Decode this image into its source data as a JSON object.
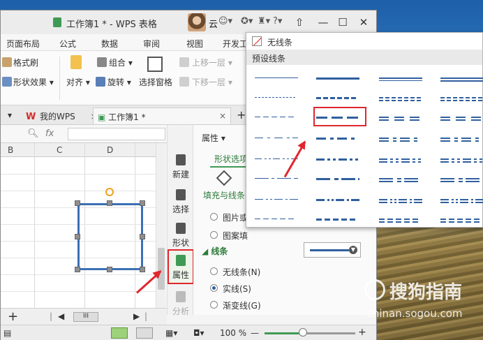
{
  "window": {
    "title": "工作簿1 * - WPS 表格",
    "user": "云",
    "help": "?"
  },
  "menu": [
    "页面布局",
    "公式",
    "数据",
    "审阅",
    "视图",
    "开发工"
  ],
  "ribbon": {
    "format_painter": "格式刷",
    "shape_effect": "形状效果",
    "combine": "组合",
    "align": "对齐",
    "rotate": "旋转",
    "selection_pane": "选择窗格",
    "bring_forward": "上移一层",
    "send_backward": "下移一层"
  },
  "tabs": {
    "my_wps": "我的WPS",
    "workbook": "工作簿1 *",
    "close": "×",
    "new": "+"
  },
  "formula": {
    "search": "",
    "fx": "fx"
  },
  "grid": {
    "columns": [
      "B",
      "C",
      "D"
    ]
  },
  "sidebar": {
    "new": "新建",
    "select": "选择",
    "shape": "形状",
    "property": "属性",
    "analyze": "分析"
  },
  "property_panel": {
    "title": "属性 ▾",
    "tab": "形状选项",
    "fill_and_line": "填充与线条",
    "fill_picture": "图片或",
    "fill_pattern": "图案填",
    "line_section": "线条",
    "no_line": "无线条(N)",
    "solid_line": "实线(S)",
    "gradient_line": "渐变线(G)"
  },
  "dropdown": {
    "no_line": "无线条",
    "preset_header": "预设线条",
    "selected_row": 2,
    "selected_col": 1
  },
  "status": {
    "zoom": "100 %",
    "zoom_level": 0.42,
    "minus": "—",
    "plus": "+"
  },
  "watermark": {
    "brand": "搜狗指南",
    "url": "zhinan.sogou.com"
  },
  "colors": {
    "accent_green": "#3f9a55",
    "highlight_red": "#e0262e",
    "line_blue": "#2f5f9e"
  }
}
